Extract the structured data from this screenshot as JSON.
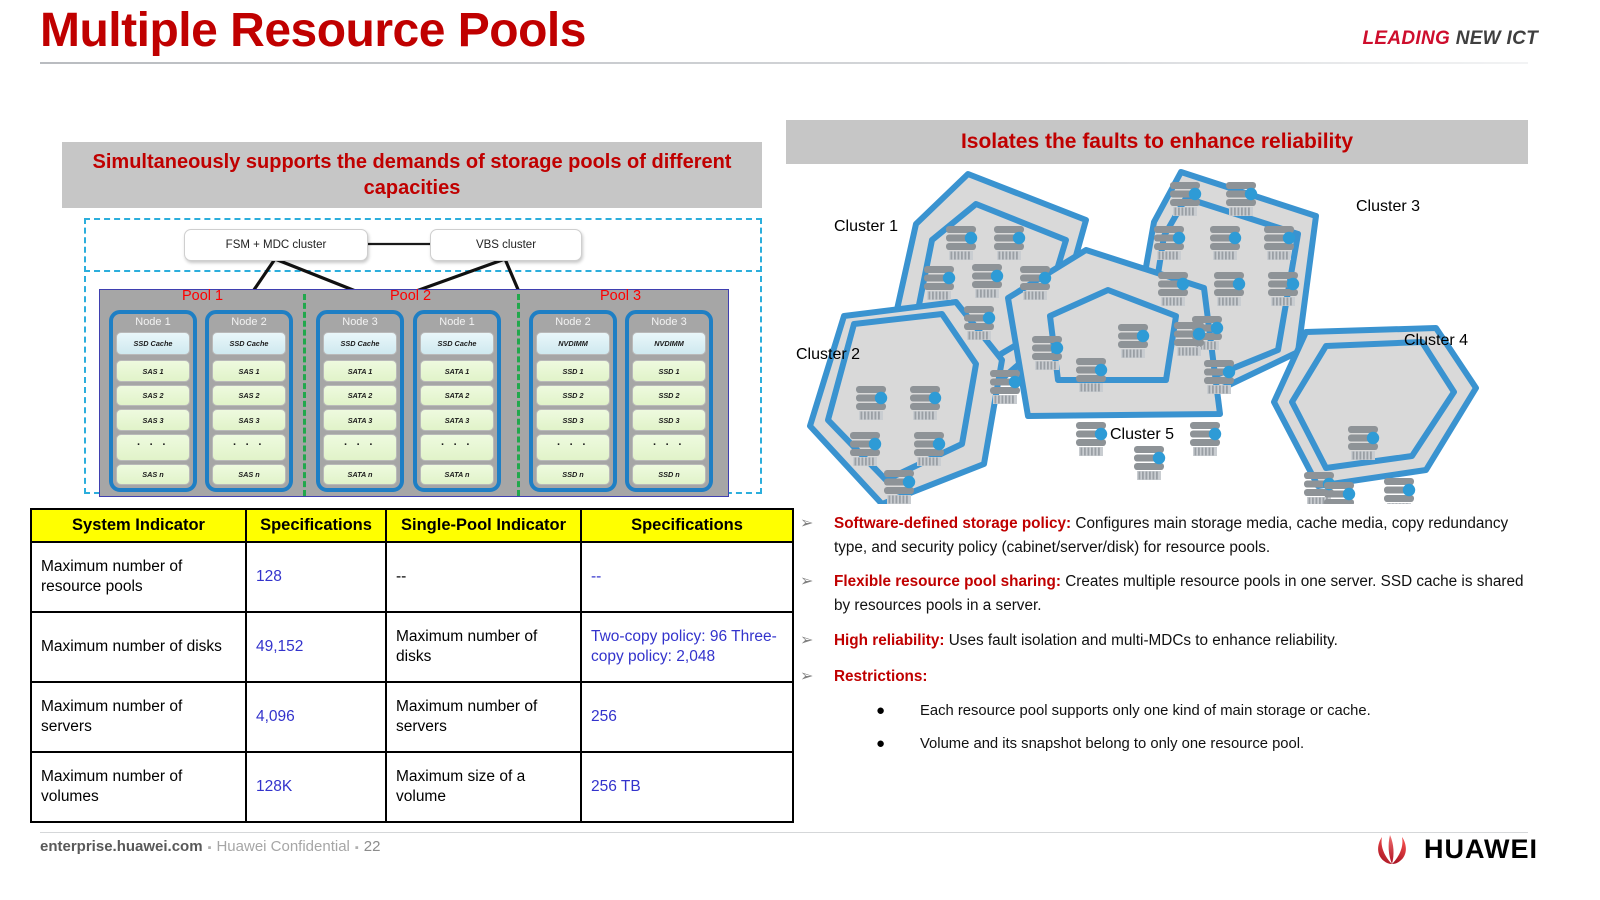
{
  "header": {
    "title": "Multiple Resource Pools",
    "brand_leading": "LEADING",
    "brand_newict": "NEW ICT",
    "accent_red": "#C00000",
    "brand_red": "#CE0E2D"
  },
  "left": {
    "banner": "Simultaneously supports the demands of storage pools of different capacities",
    "chips": {
      "fsm": "FSM + MDC cluster",
      "vbs": "VBS cluster"
    },
    "pools": [
      {
        "label": "Pool 1"
      },
      {
        "label": "Pool 2"
      },
      {
        "label": "Pool 3"
      }
    ],
    "nodes": [
      {
        "title": "Node 1",
        "cache": "SSD Cache",
        "disks": [
          "SAS 1",
          "SAS 2",
          "SAS 3",
          "SAS n"
        ]
      },
      {
        "title": "Node 2",
        "cache": "SSD Cache",
        "disks": [
          "SAS 1",
          "SAS 2",
          "SAS 3",
          "SAS n"
        ]
      },
      {
        "title": "Node 3",
        "cache": "SSD Cache",
        "disks": [
          "SATA 1",
          "SATA 2",
          "SATA 3",
          "SATA n"
        ]
      },
      {
        "title": "Node 1",
        "cache": "SSD Cache",
        "disks": [
          "SATA 1",
          "SATA 2",
          "SATA 3",
          "SATA n"
        ]
      },
      {
        "title": "Node 2",
        "cache": "NVDIMM",
        "disks": [
          "SSD 1",
          "SSD 2",
          "SSD 3",
          "SSD n"
        ]
      },
      {
        "title": "Node 3",
        "cache": "NVDIMM",
        "disks": [
          "SSD 1",
          "SSD 2",
          "SSD 3",
          "SSD n"
        ]
      }
    ],
    "dots": "· · ·"
  },
  "table": {
    "headers": [
      "System Indicator",
      "Specifications",
      "Single-Pool Indicator",
      "Specifications"
    ],
    "rows": [
      {
        "indicator": "Maximum number of resource pools",
        "spec": "128",
        "pool_indicator": "--",
        "pool_spec": "--"
      },
      {
        "indicator": "Maximum number of disks",
        "spec": "49,152",
        "pool_indicator": "Maximum number of disks",
        "pool_spec": "Two-copy policy: 96 Three-copy policy: 2,048"
      },
      {
        "indicator": "Maximum number of servers",
        "spec": "4,096",
        "pool_indicator": "Maximum number of servers",
        "pool_spec": "256"
      },
      {
        "indicator": "Maximum number of volumes",
        "spec": "128K",
        "pool_indicator": "Maximum size of a volume",
        "pool_spec": "256 TB"
      }
    ]
  },
  "right": {
    "banner": "Isolates the faults to enhance reliability",
    "clusters": [
      {
        "label": "Cluster 1"
      },
      {
        "label": "Cluster 2"
      },
      {
        "label": "Cluster 3"
      },
      {
        "label": "Cluster 4"
      },
      {
        "label": "Cluster 5"
      }
    ],
    "cluster_outline_color": "#3A93D0",
    "cluster_fill_color": "#D9D9D9",
    "server_accent_color": "#2E9BD6",
    "bullets": [
      {
        "marker": "➢",
        "head": "Software-defined storage policy:",
        "text": " Configures main storage media, cache media, copy redundancy type, and security policy (cabinet/server/disk) for resource pools."
      },
      {
        "marker": "➢",
        "head": "Flexible resource pool sharing:",
        "text": " Creates multiple resource pools in one server. SSD cache is shared by resources pools in a server."
      },
      {
        "marker": "➢",
        "head": "High reliability:",
        "text": " Uses fault isolation and multi-MDCs to enhance reliability."
      },
      {
        "marker": "➢",
        "head": "Restrictions:",
        "text": ""
      }
    ],
    "subbullets": [
      {
        "marker": "●",
        "text": "Each resource pool supports only one kind of main storage or cache."
      },
      {
        "marker": "●",
        "text": "Volume and its snapshot belong to only one resource pool."
      }
    ]
  },
  "footer": {
    "site": "enterprise.huawei.com",
    "sep": "▪",
    "confidential": "Huawei Confidential",
    "page": "22",
    "logo_word": "HUAWEI",
    "logo_red": "#CF0A2C"
  }
}
